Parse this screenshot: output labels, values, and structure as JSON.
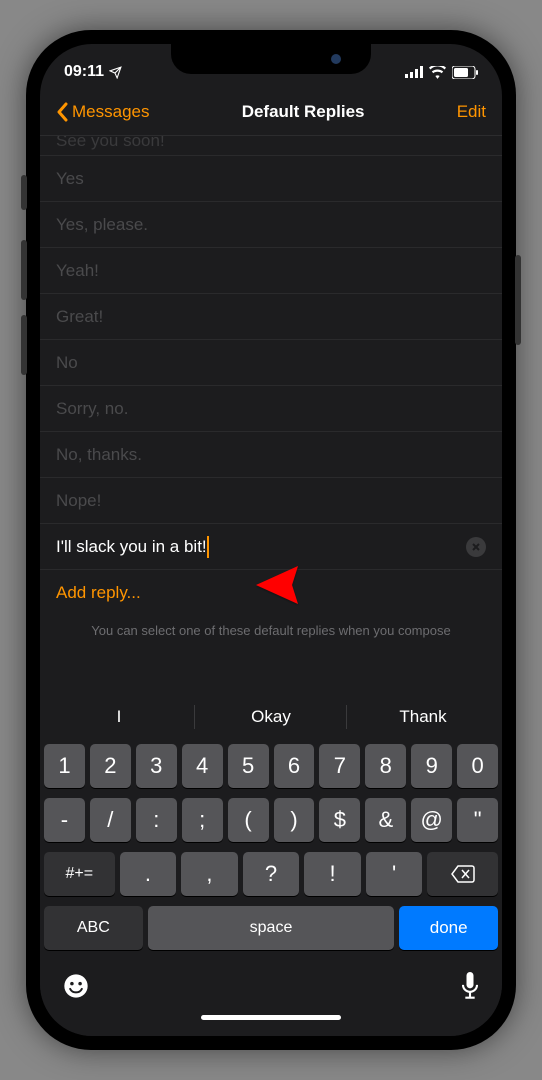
{
  "statusBar": {
    "time": "09:11",
    "locationIcon": "location-arrow"
  },
  "nav": {
    "back": "Messages",
    "title": "Default Replies",
    "edit": "Edit"
  },
  "replies": {
    "items": [
      "See you soon!",
      "Yes",
      "Yes, please.",
      "Yeah!",
      "Great!",
      "No",
      "Sorry, no.",
      "No, thanks.",
      "Nope!"
    ],
    "inputValue": "I'll slack you in a bit!",
    "addReplyLabel": "Add reply...",
    "footer": "You can select one of these default replies when you compose"
  },
  "keyboard": {
    "suggestions": [
      "I",
      "Okay",
      "Thank"
    ],
    "row1": [
      "1",
      "2",
      "3",
      "4",
      "5",
      "6",
      "7",
      "8",
      "9",
      "0"
    ],
    "row2": [
      "-",
      "/",
      ":",
      ";",
      "(",
      ")",
      "$",
      "&",
      "@",
      "\""
    ],
    "row3Shift": "#+=",
    "row3Keys": [
      ".",
      ",",
      "?",
      "!",
      "'"
    ],
    "abc": "ABC",
    "space": "space",
    "done": "done"
  }
}
